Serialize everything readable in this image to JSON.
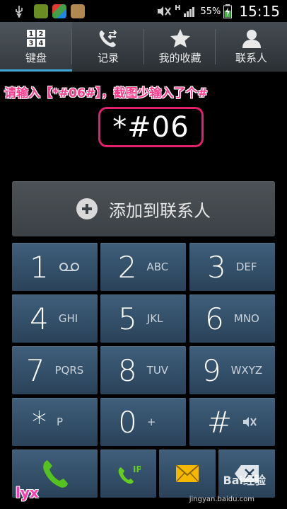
{
  "status_bar": {
    "battery_percent": "55%",
    "time": "15:15",
    "network_type": "H",
    "left_icons": [
      "usb-icon",
      "app-notification-icon",
      "app-notification-icon",
      "app-notification-icon"
    ],
    "right_icons": [
      "mute-icon",
      "signal-icon",
      "battery-charging-icon"
    ]
  },
  "tabs": [
    {
      "label": "键盘",
      "icon": "keypad-icon",
      "active": true
    },
    {
      "label": "记录",
      "icon": "call-log-icon",
      "active": false
    },
    {
      "label": "我的收藏",
      "icon": "star-icon",
      "active": false
    },
    {
      "label": "联系人",
      "icon": "person-icon",
      "active": false
    }
  ],
  "annotation": "请输入【*#06#】，截图少输入了个#",
  "dialed_number": "*#06",
  "add_contact": {
    "label": "添加到联系人",
    "icon": "plus-circle-icon"
  },
  "keys": [
    {
      "digit": "1",
      "sub": "",
      "sub_icon": "voicemail-icon"
    },
    {
      "digit": "2",
      "sub": "ABC"
    },
    {
      "digit": "3",
      "sub": "DEF"
    },
    {
      "digit": "4",
      "sub": "GHI"
    },
    {
      "digit": "5",
      "sub": "JKL"
    },
    {
      "digit": "6",
      "sub": "MNO"
    },
    {
      "digit": "7",
      "sub": "PQRS"
    },
    {
      "digit": "8",
      "sub": "TUV"
    },
    {
      "digit": "9",
      "sub": "WXYZ"
    },
    {
      "digit": "*",
      "sub": "P"
    },
    {
      "digit": "0",
      "sub": "+"
    },
    {
      "digit": "#",
      "sub": "",
      "sub_icon": "mute-icon"
    }
  ],
  "bottom_row": {
    "call": {
      "icon": "phone-icon",
      "color": "#2e7d32"
    },
    "ip_call": {
      "icon": "ip-call-icon",
      "label": "IP",
      "color": "#66bb00"
    },
    "message": {
      "icon": "envelope-icon",
      "color": "#f5b800"
    },
    "delete": {
      "icon": "backspace-icon"
    }
  },
  "watermark": {
    "text": "Bai经验",
    "url_text": "jingyan.baidu.com"
  },
  "author": "lyx"
}
